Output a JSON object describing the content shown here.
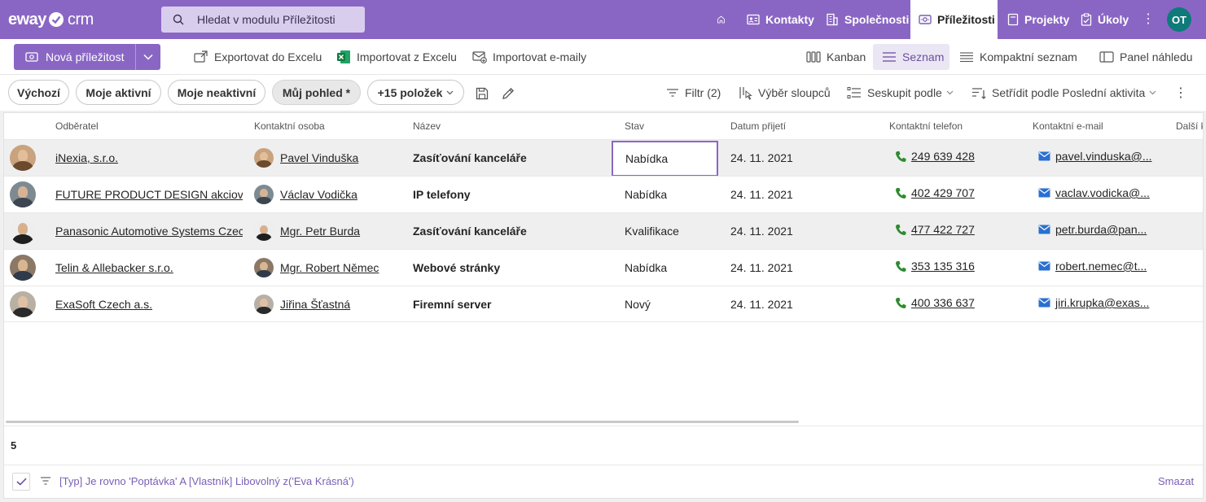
{
  "app": {
    "logo_text": "eway",
    "logo_suffix": "crm"
  },
  "search": {
    "placeholder": "Hledat v modulu Příležitosti"
  },
  "nav": {
    "items": [
      {
        "label": "Kontakty"
      },
      {
        "label": "Společnosti"
      },
      {
        "label": "Příležitosti",
        "active": true
      },
      {
        "label": "Projekty"
      },
      {
        "label": "Úkoly"
      }
    ],
    "more": "⋮",
    "user_initials": "OT"
  },
  "toolbar": {
    "new_label": "Nová příležitost",
    "export_excel": "Exportovat do Excelu",
    "import_excel": "Importovat z Excelu",
    "import_emails": "Importovat e-maily",
    "kanban": "Kanban",
    "list": "Seznam",
    "compact_list": "Kompaktní seznam",
    "preview_panel": "Panel náhledu"
  },
  "views": {
    "pills": [
      "Výchozí",
      "Moje aktivní",
      "Moje neaktivní",
      "Můj pohled *",
      "+15 položek"
    ],
    "active_index": 3,
    "filter": "Filtr (2)",
    "column_chooser": "Výběr sloupců",
    "group_by": "Seskupit podle",
    "sort_by": "Setřídit podle Poslední aktivita",
    "more": "⋮"
  },
  "grid": {
    "columns": [
      "Odběratel",
      "Kontaktní osoba",
      "Název",
      "Stav",
      "Datum přijetí",
      "Kontaktní telefon",
      "Kontaktní e-mail",
      "Další k"
    ],
    "rows": [
      {
        "company": "iNexia, s.r.o.",
        "person": "Pavel Vinduška",
        "title": "Zasíťování kanceláře",
        "status": "Nabídka",
        "date": "24. 11. 2021",
        "phone": "249 639 428",
        "email": "pavel.vinduska@..."
      },
      {
        "company": "FUTURE PRODUCT DESIGN akciová sp",
        "person": "Václav Vodička",
        "title": "IP telefony",
        "status": "Nabídka",
        "date": "24. 11. 2021",
        "phone": "402 429 707",
        "email": "vaclav.vodicka@..."
      },
      {
        "company": "Panasonic Automotive Systems Czech",
        "person": "Mgr. Petr Burda",
        "title": "Zasíťování kanceláře",
        "status": "Kvalifikace",
        "date": "24. 11. 2021",
        "phone": "477 422 727",
        "email": "petr.burda@pan..."
      },
      {
        "company": "Telin & Allebacker s.r.o.",
        "person": "Mgr. Robert Němec",
        "title": "Webové stránky",
        "status": "Nabídka",
        "date": "24. 11. 2021",
        "phone": "353 135 316",
        "email": "robert.nemec@t..."
      },
      {
        "company": "ExaSoft Czech a.s.",
        "person": "Jiřina Šťastná",
        "title": "Firemní server",
        "status": "Nový",
        "date": "24. 11. 2021",
        "phone": "400 336 637",
        "email": "jiri.krupka@exas..."
      }
    ],
    "count": "5"
  },
  "footer": {
    "filter_text": "[Typ] Je rovno 'Poptávka' A [Vlastník] Libovolný z('Eva Krásná')",
    "clear_label": "Smazat"
  },
  "colors": {
    "brand": "#8a66c4",
    "phone_icon": "#2e8b2e",
    "mail_icon": "#2a6fd1",
    "avatar_ot": "#0f7a7a"
  }
}
